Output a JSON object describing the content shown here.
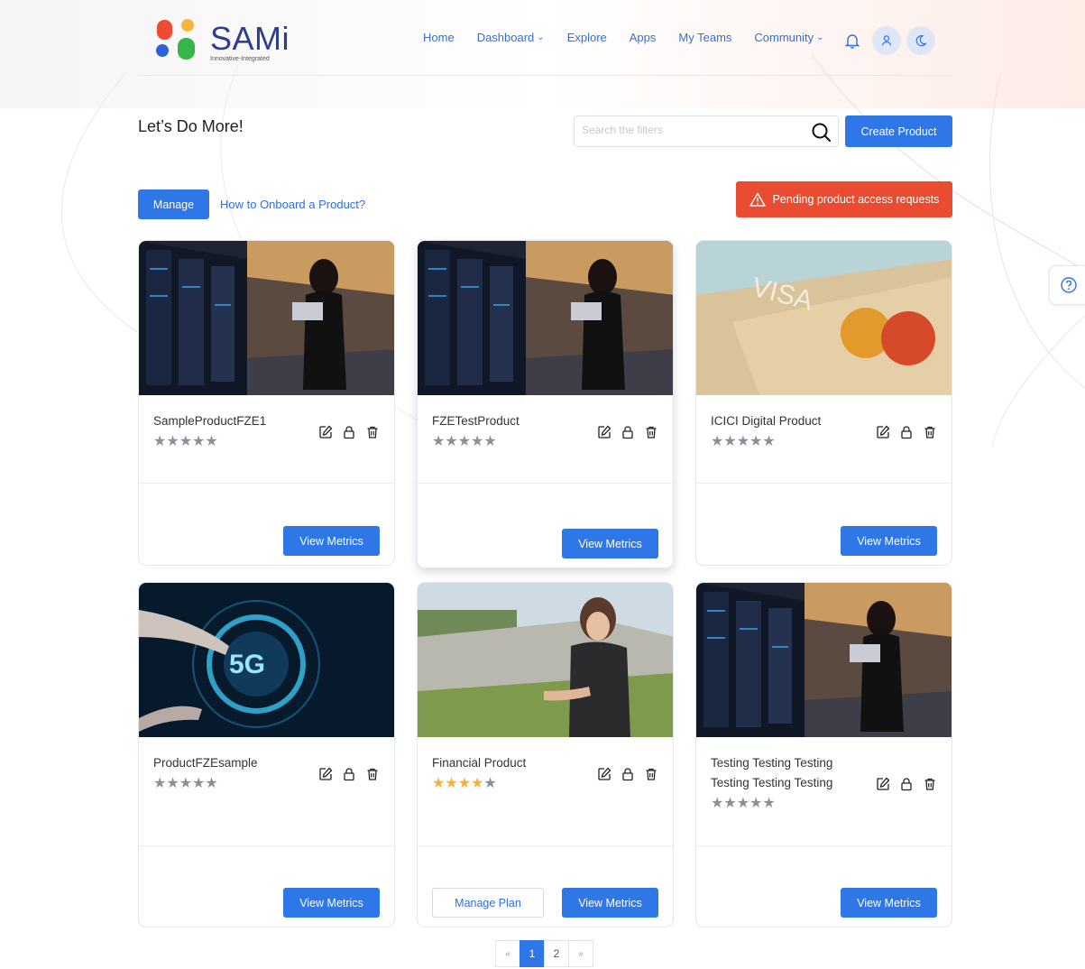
{
  "app": {
    "logo_text": "SAMi",
    "logo_tagline": "Innovative-Integrated"
  },
  "nav": {
    "items": [
      {
        "label": "Home",
        "has_dropdown": false
      },
      {
        "label": "Dashboard",
        "has_dropdown": true
      },
      {
        "label": "Explore",
        "has_dropdown": false
      },
      {
        "label": "Apps",
        "has_dropdown": false
      },
      {
        "label": "My Teams",
        "has_dropdown": false
      },
      {
        "label": "Community",
        "has_dropdown": true
      }
    ],
    "icons": [
      "bell-icon",
      "user-icon",
      "moon-icon"
    ]
  },
  "page": {
    "title": "Let’s Do More!",
    "search_placeholder": "Search the filters",
    "search_value": "",
    "create_label": "Create Product",
    "manage_label": "Manage",
    "onboard_link": "How to Onboard a Product?",
    "pending_label": "Pending product access requests"
  },
  "colors": {
    "primary": "#2f77e6",
    "danger": "#ea4c32",
    "star_on": "#f2b33d",
    "star_off": "#8a8f99"
  },
  "cards": [
    {
      "name": "SampleProductFZE1",
      "rating": 0,
      "image": "server-room",
      "view_label": "View Metrics",
      "plan_label": ""
    },
    {
      "name": "FZETestProduct",
      "rating": 0,
      "image": "server-room",
      "view_label": "View Metrics",
      "plan_label": ""
    },
    {
      "name": "ICICI Digital Product",
      "rating": 0,
      "image": "credit-cards",
      "view_label": "View Metrics",
      "plan_label": ""
    },
    {
      "name": "ProductFZEsample",
      "rating": 0,
      "image": "5g-hand",
      "view_label": "View Metrics",
      "plan_label": ""
    },
    {
      "name": "Financial Product",
      "rating": 4,
      "image": "runner-watch",
      "view_label": "View Metrics",
      "plan_label": "Manage Plan"
    },
    {
      "name": "Testing Testing Testing Testing Testing Testing",
      "rating": 0,
      "image": "server-room",
      "view_label": "View Metrics",
      "plan_label": ""
    }
  ],
  "pagination": {
    "prev": "«",
    "pages": [
      "1",
      "2"
    ],
    "current": "1",
    "next": "»"
  }
}
